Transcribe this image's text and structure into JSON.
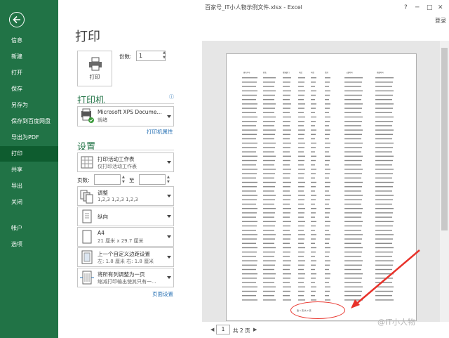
{
  "window": {
    "title": "百家号_IT小人物示例文件.xlsx - Excel",
    "login": "登录",
    "minimize": "?",
    "restore": "─",
    "maximize": "□",
    "close": "✕"
  },
  "sidebar": {
    "items": [
      {
        "label": "信息"
      },
      {
        "label": "新建"
      },
      {
        "label": "打开"
      },
      {
        "label": "保存"
      },
      {
        "label": "另存为"
      },
      {
        "label": "保存到百度网盘"
      },
      {
        "label": "导出为PDF"
      },
      {
        "label": "打印",
        "selected": true
      },
      {
        "label": "共享"
      },
      {
        "label": "导出"
      },
      {
        "label": "关闭"
      },
      {
        "label": "帐户"
      },
      {
        "label": "选项"
      }
    ]
  },
  "print": {
    "title": "打印",
    "button": "打印",
    "copies_label": "份数:",
    "copies": "1",
    "printer_header": "打印机",
    "printer_name": "Microsoft XPS Docume...",
    "printer_status": "就绪",
    "printer_props": "打印机属性",
    "settings_header": "设置",
    "what": {
      "t1": "打印活动工作表",
      "t2": "仅打印活动工作表"
    },
    "pages_label": "页数:",
    "to_label": "至",
    "collate": {
      "t1": "调整",
      "t2": "1,2,3    1,2,3    1,2,3"
    },
    "orientation": {
      "t1": "纵向"
    },
    "paper": {
      "t1": "A4",
      "t2": "21 厘米 x 29.7 厘米"
    },
    "margins": {
      "t1": "上一个自定义边距设置",
      "t2": "左: 1.8 厘米    右: 1.8 厘米"
    },
    "scaling": {
      "t1": "将所有列调整为一页",
      "t2": "缩减打印输出使其只有一..."
    },
    "page_setup": "页面设置"
  },
  "preview": {
    "headers": [
      "编号序号",
      "姓名",
      "所属部门",
      "电话",
      "年龄",
      "性别",
      "入职时间",
      "离职时间"
    ],
    "page_number": "第 1 页 共 2 页",
    "nav": {
      "current": "1",
      "of": "共 2 页",
      "prev": "◀",
      "next": "▶"
    }
  },
  "watermark": "@IT小人物",
  "colors": {
    "accent": "#217346",
    "annotation": "#e8322a",
    "link": "#2e75b6"
  }
}
